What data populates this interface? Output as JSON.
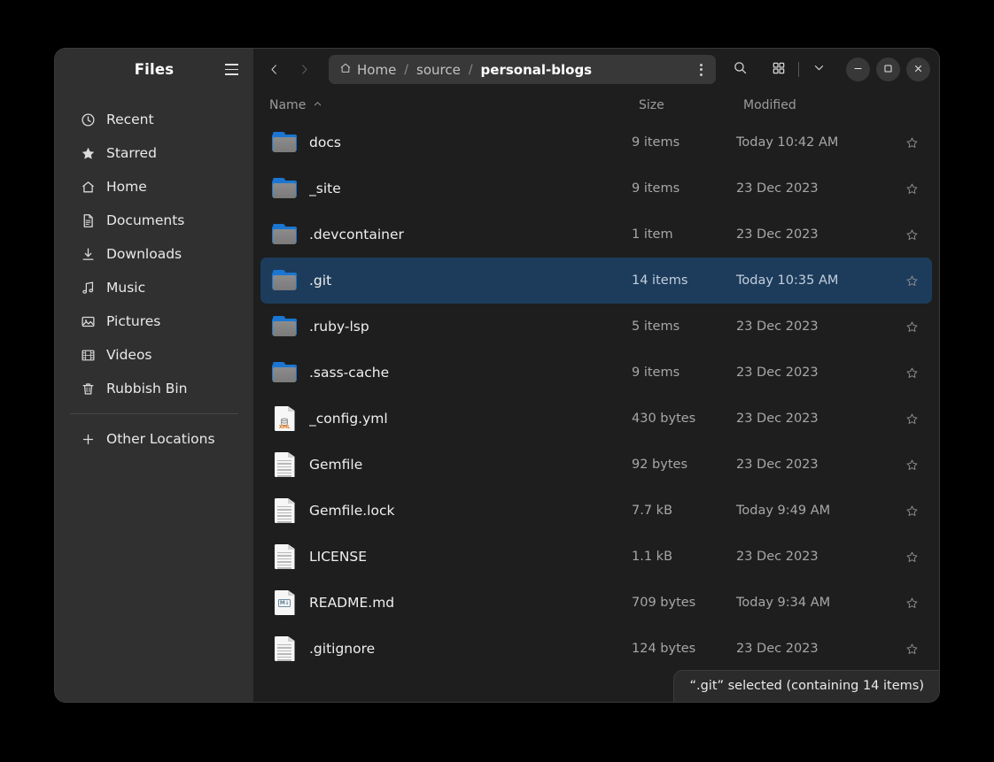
{
  "window": {
    "sidebar_title": "Files",
    "menu_icon": "hamburger-icon"
  },
  "headerbar": {
    "back_icon": "chevron-left-icon",
    "forward_icon": "chevron-right-icon",
    "search_icon": "search-icon",
    "view_grid_icon": "grid-view-icon",
    "view_menu_icon": "chevron-down-icon",
    "minimize_icon": "minimize-icon",
    "maximize_icon": "maximize-icon",
    "close_icon": "close-icon",
    "path_menu_icon": "kebab-menu-icon"
  },
  "breadcrumb": {
    "home_icon": "home-icon",
    "items": [
      {
        "label": "Home",
        "current": false
      },
      {
        "label": "source",
        "current": false
      },
      {
        "label": "personal-blogs",
        "current": true
      }
    ],
    "separator": "/"
  },
  "sidebar": {
    "items": [
      {
        "label": "Recent",
        "icon": "clock-icon"
      },
      {
        "label": "Starred",
        "icon": "star-icon"
      },
      {
        "label": "Home",
        "icon": "home-icon"
      },
      {
        "label": "Documents",
        "icon": "document-icon"
      },
      {
        "label": "Downloads",
        "icon": "download-icon"
      },
      {
        "label": "Music",
        "icon": "music-note-icon"
      },
      {
        "label": "Pictures",
        "icon": "image-icon"
      },
      {
        "label": "Videos",
        "icon": "video-icon"
      },
      {
        "label": "Rubbish Bin",
        "icon": "trash-icon"
      }
    ],
    "other_locations": {
      "label": "Other Locations",
      "icon": "plus-icon"
    }
  },
  "columns": {
    "name": "Name",
    "name_sort_icon": "chevron-up-icon",
    "size": "Size",
    "modified": "Modified"
  },
  "files": [
    {
      "name": "docs",
      "size": "9 items",
      "modified": "Today 10:42 AM",
      "kind": "folder",
      "selected": false,
      "star_icon": "star-outline-icon"
    },
    {
      "name": "_site",
      "size": "9 items",
      "modified": "23 Dec 2023",
      "kind": "folder",
      "selected": false,
      "star_icon": "star-outline-icon"
    },
    {
      "name": ".devcontainer",
      "size": "1 item",
      "modified": "23 Dec 2023",
      "kind": "folder",
      "selected": false,
      "star_icon": "star-outline-icon"
    },
    {
      "name": ".git",
      "size": "14 items",
      "modified": "Today 10:35 AM",
      "kind": "folder",
      "selected": true,
      "star_icon": "star-outline-icon"
    },
    {
      "name": ".ruby-lsp",
      "size": "5 items",
      "modified": "23 Dec 2023",
      "kind": "folder",
      "selected": false,
      "star_icon": "star-outline-icon"
    },
    {
      "name": ".sass-cache",
      "size": "9 items",
      "modified": "23 Dec 2023",
      "kind": "folder",
      "selected": false,
      "star_icon": "star-outline-icon"
    },
    {
      "name": "_config.yml",
      "size": "430 bytes",
      "modified": "23 Dec 2023",
      "kind": "yaml",
      "selected": false,
      "star_icon": "star-outline-icon"
    },
    {
      "name": "Gemfile",
      "size": "92 bytes",
      "modified": "23 Dec 2023",
      "kind": "text",
      "selected": false,
      "star_icon": "star-outline-icon"
    },
    {
      "name": "Gemfile.lock",
      "size": "7.7 kB",
      "modified": "Today 9:49 AM",
      "kind": "text",
      "selected": false,
      "star_icon": "star-outline-icon"
    },
    {
      "name": "LICENSE",
      "size": "1.1 kB",
      "modified": "23 Dec 2023",
      "kind": "text",
      "selected": false,
      "star_icon": "star-outline-icon"
    },
    {
      "name": "README.md",
      "size": "709 bytes",
      "modified": "Today 9:34 AM",
      "kind": "markdown",
      "selected": false,
      "star_icon": "star-outline-icon"
    },
    {
      "name": ".gitignore",
      "size": "124 bytes",
      "modified": "23 Dec 2023",
      "kind": "text",
      "selected": false,
      "star_icon": "star-outline-icon"
    }
  ],
  "status": {
    "text": "“.git” selected (containing 14 items)"
  },
  "colors": {
    "selection": "#1d3c5c",
    "folder_accent": "#1a76d2",
    "sidebar_bg": "#303030",
    "main_bg": "#1e1e1e",
    "pathbar_bg": "#383838"
  },
  "icon_badges": {
    "yaml": "XML",
    "markdown": "M↓"
  }
}
